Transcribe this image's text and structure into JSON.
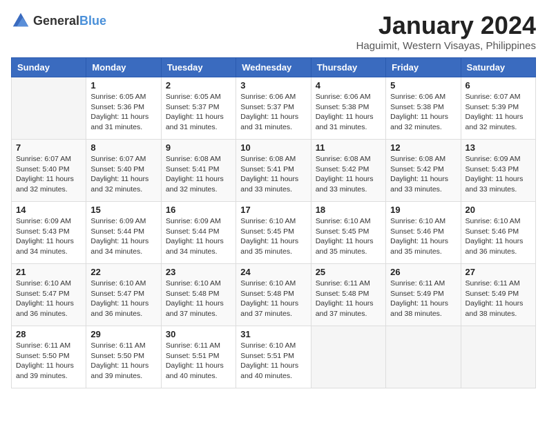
{
  "header": {
    "logo_general": "General",
    "logo_blue": "Blue",
    "month_title": "January 2024",
    "location": "Haguimit, Western Visayas, Philippines"
  },
  "days_of_week": [
    "Sunday",
    "Monday",
    "Tuesday",
    "Wednesday",
    "Thursday",
    "Friday",
    "Saturday"
  ],
  "weeks": [
    [
      {
        "day": "",
        "sunrise": "",
        "sunset": "",
        "daylight": ""
      },
      {
        "day": "1",
        "sunrise": "Sunrise: 6:05 AM",
        "sunset": "Sunset: 5:36 PM",
        "daylight": "Daylight: 11 hours and 31 minutes."
      },
      {
        "day": "2",
        "sunrise": "Sunrise: 6:05 AM",
        "sunset": "Sunset: 5:37 PM",
        "daylight": "Daylight: 11 hours and 31 minutes."
      },
      {
        "day": "3",
        "sunrise": "Sunrise: 6:06 AM",
        "sunset": "Sunset: 5:37 PM",
        "daylight": "Daylight: 11 hours and 31 minutes."
      },
      {
        "day": "4",
        "sunrise": "Sunrise: 6:06 AM",
        "sunset": "Sunset: 5:38 PM",
        "daylight": "Daylight: 11 hours and 31 minutes."
      },
      {
        "day": "5",
        "sunrise": "Sunrise: 6:06 AM",
        "sunset": "Sunset: 5:38 PM",
        "daylight": "Daylight: 11 hours and 32 minutes."
      },
      {
        "day": "6",
        "sunrise": "Sunrise: 6:07 AM",
        "sunset": "Sunset: 5:39 PM",
        "daylight": "Daylight: 11 hours and 32 minutes."
      }
    ],
    [
      {
        "day": "7",
        "sunrise": "Sunrise: 6:07 AM",
        "sunset": "Sunset: 5:40 PM",
        "daylight": "Daylight: 11 hours and 32 minutes."
      },
      {
        "day": "8",
        "sunrise": "Sunrise: 6:07 AM",
        "sunset": "Sunset: 5:40 PM",
        "daylight": "Daylight: 11 hours and 32 minutes."
      },
      {
        "day": "9",
        "sunrise": "Sunrise: 6:08 AM",
        "sunset": "Sunset: 5:41 PM",
        "daylight": "Daylight: 11 hours and 32 minutes."
      },
      {
        "day": "10",
        "sunrise": "Sunrise: 6:08 AM",
        "sunset": "Sunset: 5:41 PM",
        "daylight": "Daylight: 11 hours and 33 minutes."
      },
      {
        "day": "11",
        "sunrise": "Sunrise: 6:08 AM",
        "sunset": "Sunset: 5:42 PM",
        "daylight": "Daylight: 11 hours and 33 minutes."
      },
      {
        "day": "12",
        "sunrise": "Sunrise: 6:08 AM",
        "sunset": "Sunset: 5:42 PM",
        "daylight": "Daylight: 11 hours and 33 minutes."
      },
      {
        "day": "13",
        "sunrise": "Sunrise: 6:09 AM",
        "sunset": "Sunset: 5:43 PM",
        "daylight": "Daylight: 11 hours and 33 minutes."
      }
    ],
    [
      {
        "day": "14",
        "sunrise": "Sunrise: 6:09 AM",
        "sunset": "Sunset: 5:43 PM",
        "daylight": "Daylight: 11 hours and 34 minutes."
      },
      {
        "day": "15",
        "sunrise": "Sunrise: 6:09 AM",
        "sunset": "Sunset: 5:44 PM",
        "daylight": "Daylight: 11 hours and 34 minutes."
      },
      {
        "day": "16",
        "sunrise": "Sunrise: 6:09 AM",
        "sunset": "Sunset: 5:44 PM",
        "daylight": "Daylight: 11 hours and 34 minutes."
      },
      {
        "day": "17",
        "sunrise": "Sunrise: 6:10 AM",
        "sunset": "Sunset: 5:45 PM",
        "daylight": "Daylight: 11 hours and 35 minutes."
      },
      {
        "day": "18",
        "sunrise": "Sunrise: 6:10 AM",
        "sunset": "Sunset: 5:45 PM",
        "daylight": "Daylight: 11 hours and 35 minutes."
      },
      {
        "day": "19",
        "sunrise": "Sunrise: 6:10 AM",
        "sunset": "Sunset: 5:46 PM",
        "daylight": "Daylight: 11 hours and 35 minutes."
      },
      {
        "day": "20",
        "sunrise": "Sunrise: 6:10 AM",
        "sunset": "Sunset: 5:46 PM",
        "daylight": "Daylight: 11 hours and 36 minutes."
      }
    ],
    [
      {
        "day": "21",
        "sunrise": "Sunrise: 6:10 AM",
        "sunset": "Sunset: 5:47 PM",
        "daylight": "Daylight: 11 hours and 36 minutes."
      },
      {
        "day": "22",
        "sunrise": "Sunrise: 6:10 AM",
        "sunset": "Sunset: 5:47 PM",
        "daylight": "Daylight: 11 hours and 36 minutes."
      },
      {
        "day": "23",
        "sunrise": "Sunrise: 6:10 AM",
        "sunset": "Sunset: 5:48 PM",
        "daylight": "Daylight: 11 hours and 37 minutes."
      },
      {
        "day": "24",
        "sunrise": "Sunrise: 6:10 AM",
        "sunset": "Sunset: 5:48 PM",
        "daylight": "Daylight: 11 hours and 37 minutes."
      },
      {
        "day": "25",
        "sunrise": "Sunrise: 6:11 AM",
        "sunset": "Sunset: 5:48 PM",
        "daylight": "Daylight: 11 hours and 37 minutes."
      },
      {
        "day": "26",
        "sunrise": "Sunrise: 6:11 AM",
        "sunset": "Sunset: 5:49 PM",
        "daylight": "Daylight: 11 hours and 38 minutes."
      },
      {
        "day": "27",
        "sunrise": "Sunrise: 6:11 AM",
        "sunset": "Sunset: 5:49 PM",
        "daylight": "Daylight: 11 hours and 38 minutes."
      }
    ],
    [
      {
        "day": "28",
        "sunrise": "Sunrise: 6:11 AM",
        "sunset": "Sunset: 5:50 PM",
        "daylight": "Daylight: 11 hours and 39 minutes."
      },
      {
        "day": "29",
        "sunrise": "Sunrise: 6:11 AM",
        "sunset": "Sunset: 5:50 PM",
        "daylight": "Daylight: 11 hours and 39 minutes."
      },
      {
        "day": "30",
        "sunrise": "Sunrise: 6:11 AM",
        "sunset": "Sunset: 5:51 PM",
        "daylight": "Daylight: 11 hours and 40 minutes."
      },
      {
        "day": "31",
        "sunrise": "Sunrise: 6:10 AM",
        "sunset": "Sunset: 5:51 PM",
        "daylight": "Daylight: 11 hours and 40 minutes."
      },
      {
        "day": "",
        "sunrise": "",
        "sunset": "",
        "daylight": ""
      },
      {
        "day": "",
        "sunrise": "",
        "sunset": "",
        "daylight": ""
      },
      {
        "day": "",
        "sunrise": "",
        "sunset": "",
        "daylight": ""
      }
    ]
  ]
}
